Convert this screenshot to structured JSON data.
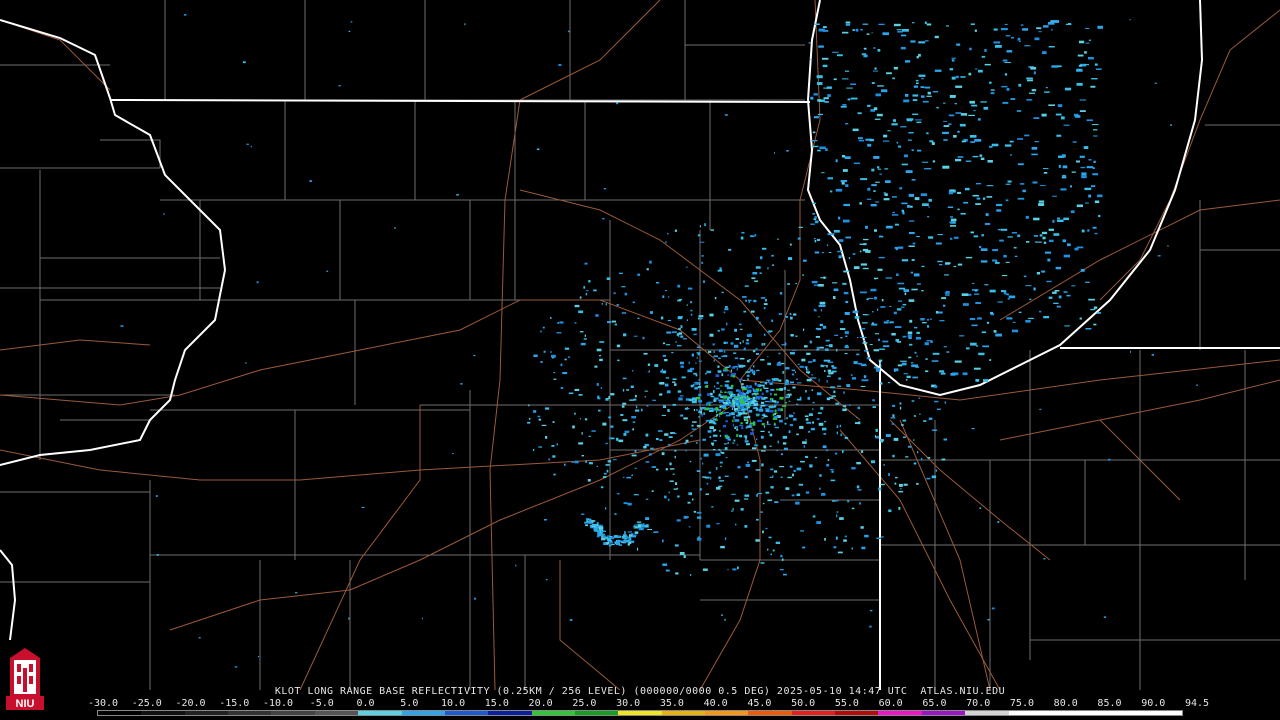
{
  "product": {
    "caption": "KLOT LONG RANGE BASE REFLECTIVITY (0.25KM / 256 LEVEL) (000000/0000 0.5 DEG) 2025-05-10 14:47 UTC  ATLAS.NIU.EDU"
  },
  "logo": {
    "text": "NIU",
    "icon": "university-tower-icon",
    "color": "#c8102e"
  },
  "legend": {
    "labels": [
      "-30.0",
      "-25.0",
      "-20.0",
      "-15.0",
      "-10.0",
      "-5.0",
      "0.0",
      "5.0",
      "10.0",
      "15.0",
      "20.0",
      "25.0",
      "30.0",
      "35.0",
      "40.0",
      "45.0",
      "50.0",
      "55.0",
      "60.0",
      "65.0",
      "70.0",
      "75.0",
      "80.0",
      "85.0",
      "90.0",
      "94.5"
    ],
    "colors": [
      "#000000",
      "#111111",
      "#222222",
      "#333333",
      "#444444",
      "#555555",
      "#5ad2e6",
      "#2aa5ee",
      "#1e5ad2",
      "#0a1ea0",
      "#2ec832",
      "#14a01e",
      "#f0e61e",
      "#e6b40a",
      "#fa9614",
      "#f05a00",
      "#e61e1e",
      "#b40a0a",
      "#f014c8",
      "#a014c8",
      "#d2d2d2",
      "#ffffff",
      "#ffffff",
      "#ffffff",
      "#ffffff"
    ]
  },
  "radar": {
    "site": "KLOT",
    "echo_colors": [
      "#2aa5ee",
      "#38c0e8",
      "#1e90e0",
      "#5ad2e6",
      "#1e5ad2",
      "#2ec832"
    ]
  }
}
